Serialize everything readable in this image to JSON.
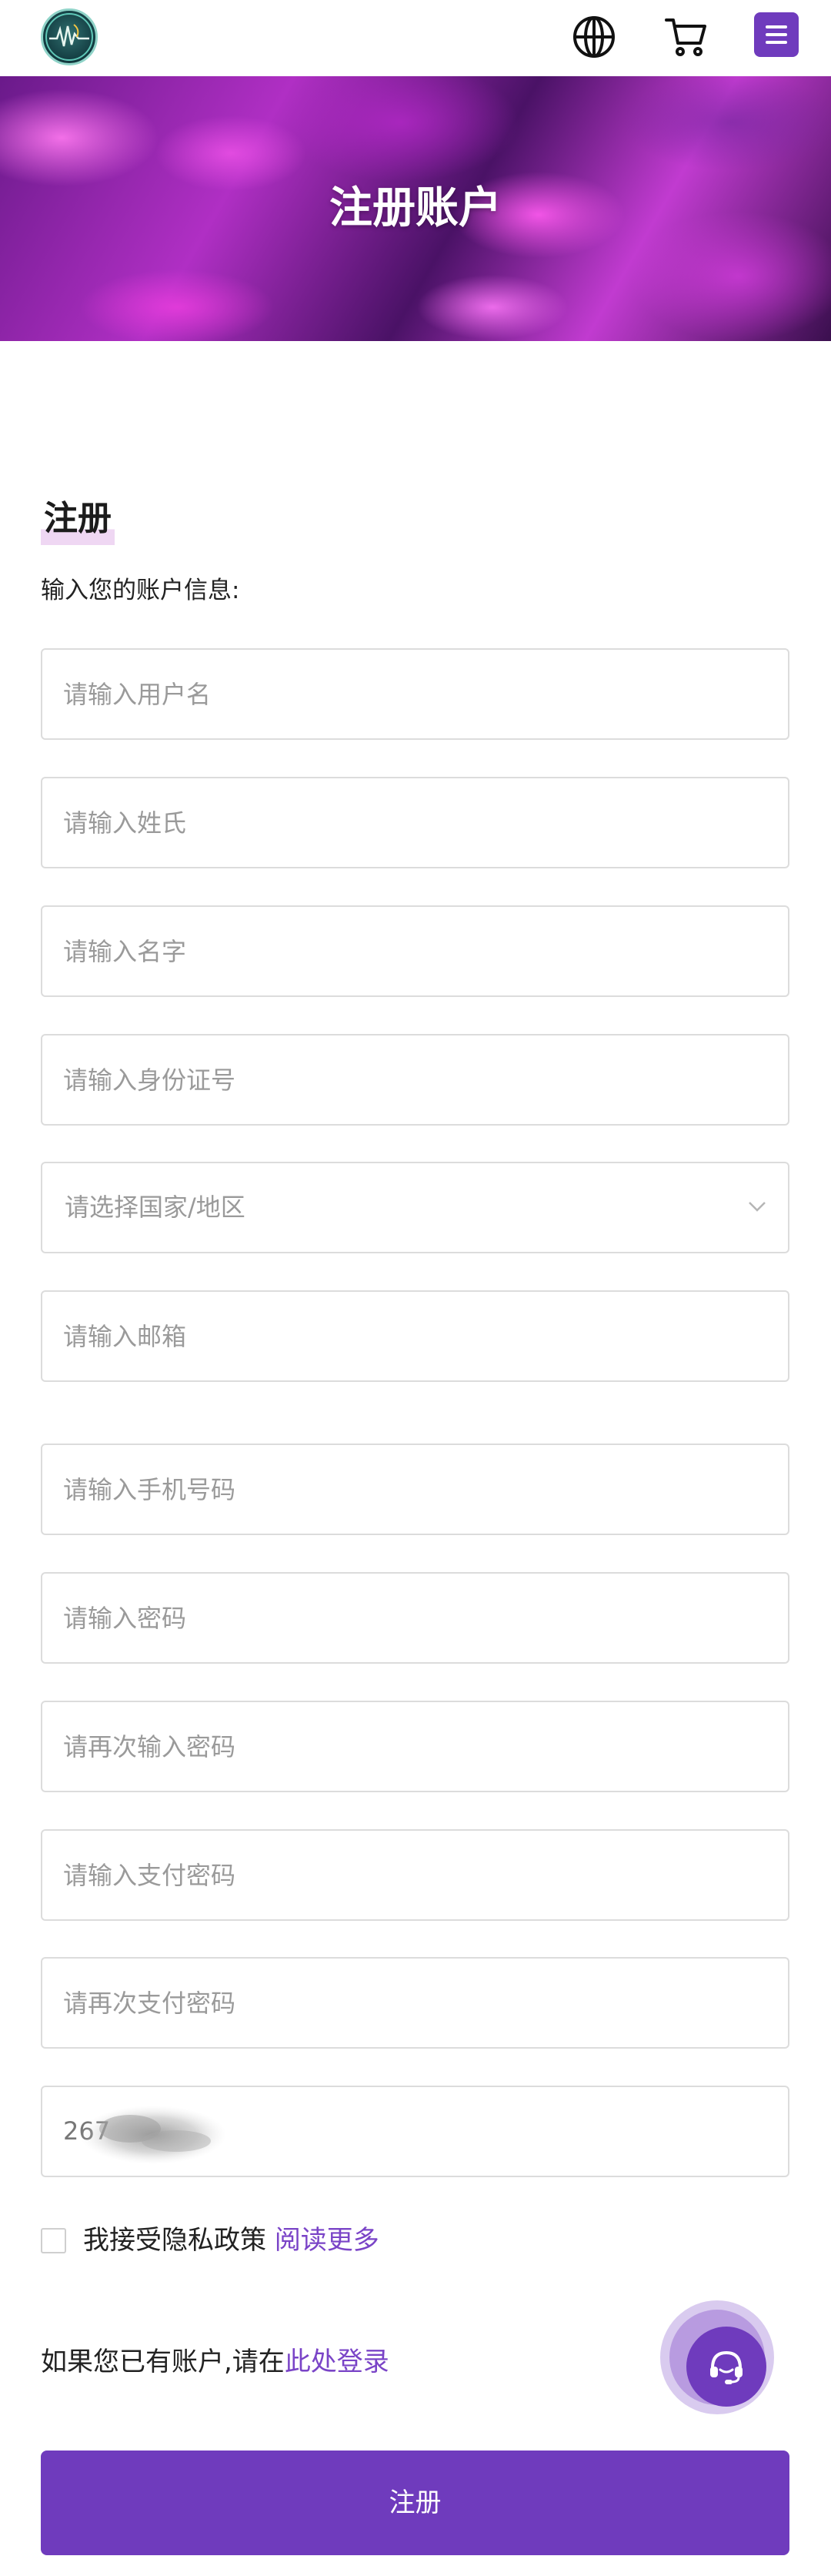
{
  "header": {
    "logo_icon": "logo-icon",
    "globe_icon": "globe-icon",
    "cart_icon": "cart-icon",
    "menu_icon": "hamburger-menu-icon",
    "accent_color": "#6f3bbd"
  },
  "banner": {
    "title": "注册账户"
  },
  "form": {
    "heading": "注册",
    "subheading": "输入您的账户信息:",
    "fields": {
      "username": {
        "placeholder": "请输入用户名",
        "value": ""
      },
      "surname": {
        "placeholder": "请输入姓氏",
        "value": ""
      },
      "given_name": {
        "placeholder": "请输入名字",
        "value": ""
      },
      "id_number": {
        "placeholder": "请输入身份证号",
        "value": ""
      },
      "country": {
        "placeholder": "请选择国家/地区"
      },
      "email": {
        "placeholder": "请输入邮箱",
        "value": ""
      },
      "phone": {
        "placeholder": "请输入手机号码",
        "value": ""
      },
      "password": {
        "placeholder": "请输入密码",
        "value": ""
      },
      "password_confirm": {
        "placeholder": "请再次输入密码",
        "value": ""
      },
      "pay_password": {
        "placeholder": "请输入支付密码",
        "value": ""
      },
      "pay_password_confirm": {
        "placeholder": "请再次支付密码",
        "value": ""
      },
      "captcha": {
        "value": "267"
      }
    },
    "agreement": {
      "text": "我接受隐私政策",
      "link": "阅读更多",
      "checked": false
    },
    "login_prompt": {
      "text": "如果您已有账户,请在",
      "link": "此处登录"
    },
    "submit_label": "注册"
  },
  "support": {
    "icon": "headset-support-icon"
  }
}
